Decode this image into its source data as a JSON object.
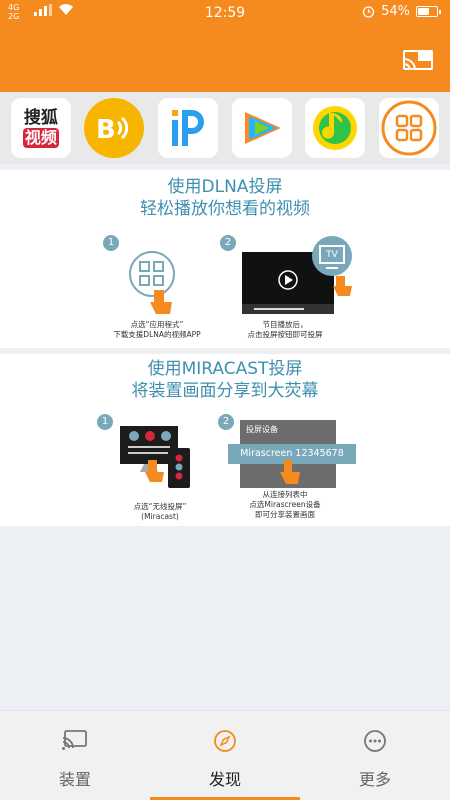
{
  "status_bar": {
    "network_top": "4G",
    "network_bottom": "2G",
    "time": "12:59",
    "battery_percent": "54%",
    "battery_level": 0.54
  },
  "apps": [
    {
      "name": "sohu-video-app-icon",
      "label_top": "搜狐",
      "label_bottom": "视频"
    },
    {
      "name": "bilibili-app-icon"
    },
    {
      "name": "iqiyi-app-icon"
    },
    {
      "name": "tencent-video-app-icon"
    },
    {
      "name": "qq-music-app-icon"
    },
    {
      "name": "more-apps-grid-icon"
    }
  ],
  "dlna": {
    "title_line1": "使用DLNA投屏",
    "title_line2": "轻松播放你想看的视频",
    "step1_num": "1",
    "step1_caption_line1": "点选“应用程式”",
    "step1_caption_line2": "下载支援DLNA的视频APP",
    "step2_num": "2",
    "step2_caption_line1": "节目播放后，",
    "step2_caption_line2": "点击投屏按钮即可投屏",
    "tv_label": "TV"
  },
  "miracast": {
    "title_line1": "使用MIRACAST投屏",
    "title_line2": "将装置画面分享到大荧幕",
    "step1_num": "1",
    "step1_caption_line1": "点选“无线投屏”",
    "step1_caption_line2": "(Miracast)",
    "step2_num": "2",
    "panel_header": "投屏设备",
    "device_name": "Mirascreen 12345678",
    "step2_caption_line1": "从连接列表中",
    "step2_caption_line2": "点选Mirascreen设备",
    "step2_caption_line3": "即可分享装置画面"
  },
  "bottom_nav": {
    "tabs": [
      {
        "label": "装置",
        "icon": "cast-icon"
      },
      {
        "label": "发现",
        "icon": "compass-icon"
      },
      {
        "label": "更多",
        "icon": "more-dots-icon"
      }
    ],
    "active_index": 1
  },
  "colors": {
    "brand_orange": "#f58a1f",
    "title_blue": "#3e8fb0",
    "step_badge": "#7aa8bb"
  }
}
